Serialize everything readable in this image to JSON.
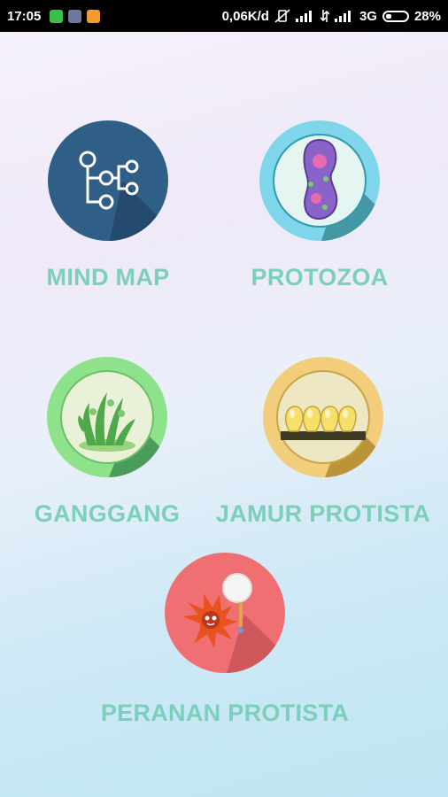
{
  "status_bar": {
    "time": "17:05",
    "network_speed": "0,06K/d",
    "network_type": "3G",
    "battery_percent": "28%",
    "battery_level": 0.28
  },
  "menu": {
    "mind_map": "MIND MAP",
    "protozoa": "PROTOZOA",
    "ganggang": "GANGGANG",
    "jamur_protista": "JAMUR PROTISTA",
    "peranan_protista": "PERANAN PROTISTA"
  },
  "colors": {
    "label_color": "#7ccfb9",
    "mind_map_circle": "#2f5f86",
    "protozoa_circle": "#7fd6ea",
    "ganggang_circle": "#8ee28b",
    "jamur_circle": "#f1cd7c",
    "peranan_circle": "#ef6f73"
  }
}
